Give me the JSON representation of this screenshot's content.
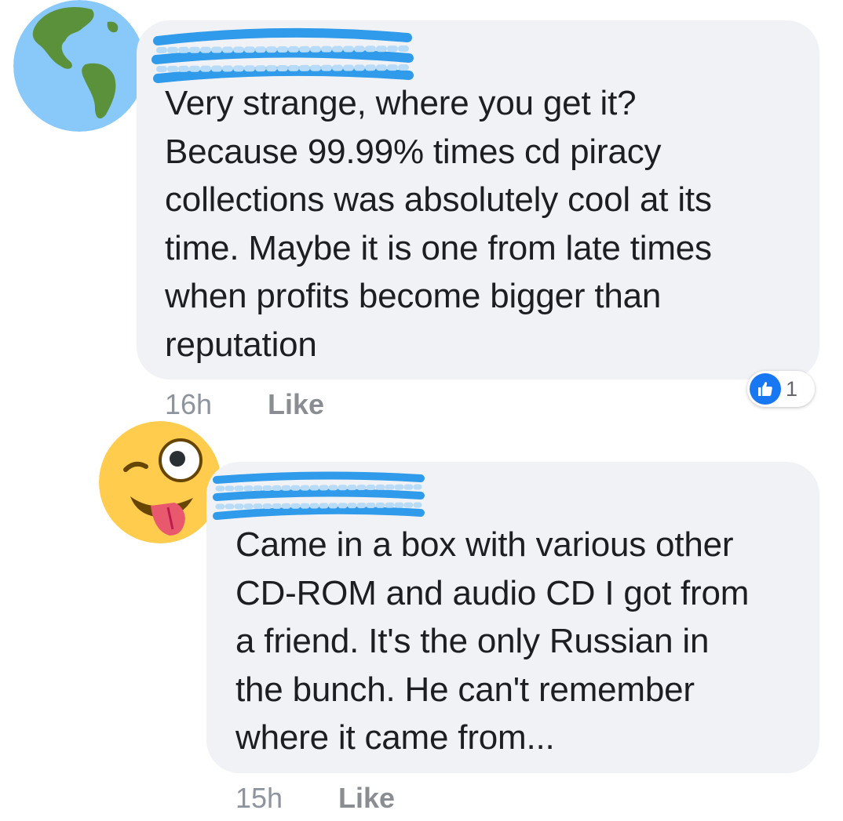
{
  "comments": [
    {
      "avatar": "globe-emoji-avatar",
      "text": "Very strange, where you get it?\nBecause 99.99% times cd piracy\ncollections was absolutely cool at its\ntime. Maybe it is one from late times\nwhen profits become bigger than\nreputation",
      "time": "16h",
      "like_label": "Like",
      "reaction_count": "1",
      "reaction_icon": "thumbs-up-icon"
    },
    {
      "avatar": "winking-tongue-emoji-avatar",
      "text": "Came in a box with various other\nCD-ROM and audio CD I got from\na friend. It's the only Russian in\nthe bunch. He can't remember\nwhere it came from...",
      "time": "15h",
      "like_label": "Like"
    }
  ],
  "colors": {
    "bubble": "#f0f2f5",
    "text": "#1c1e21",
    "meta": "#8d949e",
    "like_blue": "#1877f2",
    "redaction": "#2f9bea"
  }
}
